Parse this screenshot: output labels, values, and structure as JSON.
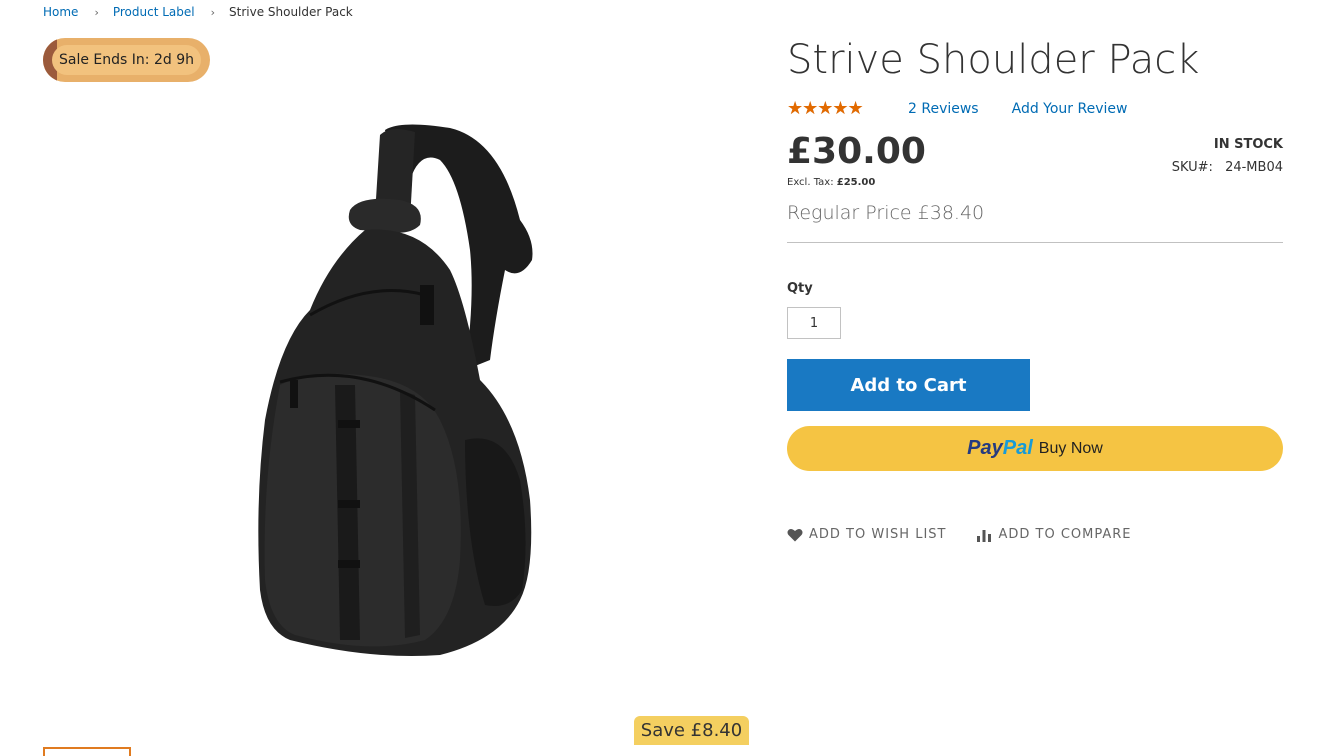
{
  "breadcrumbs": {
    "items": [
      {
        "label": "Home"
      },
      {
        "label": "Product Label"
      },
      {
        "label": "Strive Shoulder Pack"
      }
    ],
    "separator": "›"
  },
  "badges": {
    "sale": "Sale Ends In: 2d 9h",
    "save": "Save £8.40"
  },
  "product": {
    "title": "Strive Shoulder Pack",
    "rating_stars": "★★★★★",
    "rating_fraction": 0.9,
    "reviews_label": "2  Reviews",
    "add_review_label": "Add Your Review",
    "price": "£30.00",
    "excl_tax_label": "Excl. Tax:",
    "excl_tax_value": "£25.00",
    "regular_price": "Regular Price £38.40",
    "stock": "In stock",
    "sku_label": "SKU#:",
    "sku_value": "24-MB04"
  },
  "cart": {
    "qty_label": "Qty",
    "qty_value": "1",
    "add_to_cart": "Add to Cart",
    "paypal_pay": "Pay",
    "paypal_pal": "Pal",
    "paypal_buy_now": "Buy Now"
  },
  "actions": {
    "wishlist": "Add to Wish List",
    "compare": "Add to Compare"
  },
  "colors": {
    "link": "#006bb4",
    "rating": "#e26a00",
    "add_to_cart": "#1979c3",
    "paypal": "#f5c443",
    "sale_badge": "#f2c27e",
    "save_badge": "#f4cf60"
  }
}
